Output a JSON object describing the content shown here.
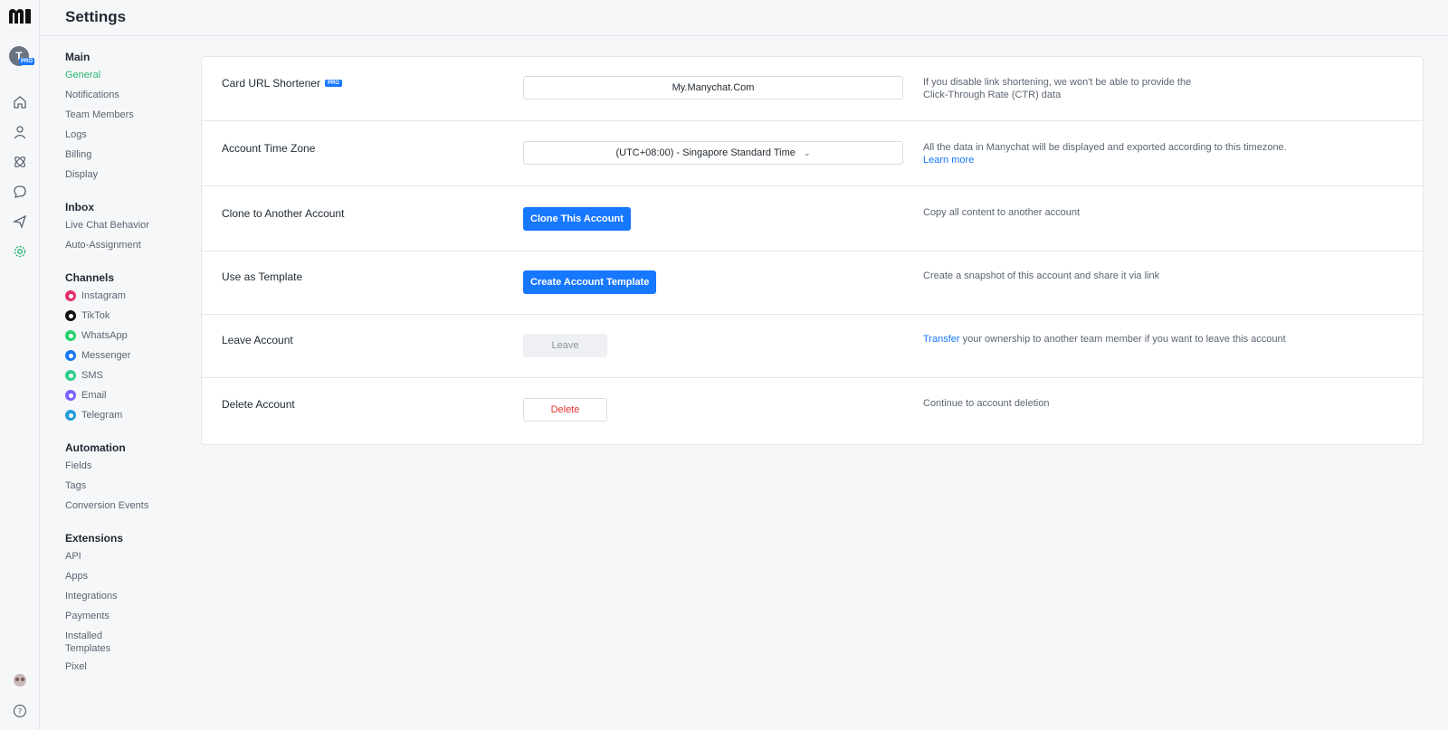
{
  "header": {
    "title": "Settings"
  },
  "rail": {
    "account_initial": "T",
    "account_badge": "PRO",
    "icons": [
      "home-icon",
      "contacts-icon",
      "automation-icon",
      "chat-icon",
      "broadcast-icon",
      "settings-icon",
      "avatar-icon",
      "help-icon"
    ]
  },
  "subnav": {
    "main": {
      "title": "Main",
      "items": [
        "General",
        "Notifications",
        "Team Members",
        "Logs",
        "Billing",
        "Display"
      ]
    },
    "inbox": {
      "title": "Inbox",
      "items": [
        "Live Chat Behavior",
        "Auto-Assignment"
      ]
    },
    "channels": {
      "title": "Channels",
      "items": [
        {
          "label": "Instagram",
          "color": "#e1306c"
        },
        {
          "label": "TikTok",
          "color": "#111111"
        },
        {
          "label": "WhatsApp",
          "color": "#25d366"
        },
        {
          "label": "Messenger",
          "color": "#1877f2"
        },
        {
          "label": "SMS",
          "color": "#2bd08a"
        },
        {
          "label": "Email",
          "color": "#7b61ff"
        },
        {
          "label": "Telegram",
          "color": "#229ed9"
        }
      ]
    },
    "automation": {
      "title": "Automation",
      "items": [
        "Fields",
        "Tags",
        "Conversion Events"
      ]
    },
    "extensions": {
      "title": "Extensions",
      "items": [
        "API",
        "Apps",
        "Integrations",
        "Payments",
        "Installed",
        "Templates",
        "Pixel"
      ]
    }
  },
  "settings": {
    "url_shortener": {
      "label": "Card URL Shortener",
      "badge": "PRO",
      "value": "My.Manychat.Com",
      "desc_line1": "If you disable link shortening, we won't be able to provide the",
      "desc_line2": "Click-Through Rate (CTR) data"
    },
    "time_zone": {
      "label": "Account Time Zone",
      "value": "(UTC+08:00) - Singapore Standard Time",
      "desc": "All the data in Manychat will be displayed and exported according to this timezone.",
      "link": "Learn more"
    },
    "clone": {
      "label": "Clone to Another Account",
      "button": "Clone This Account",
      "desc": "Copy all content to another account"
    },
    "template": {
      "label": "Use as Template",
      "button": "Create Account Template",
      "desc": "Create a snapshot of this account and share it via link"
    },
    "leave": {
      "label": "Leave Account",
      "button": "Leave",
      "link": "Transfer",
      "desc": " your ownership to another team member if you want to leave this account"
    },
    "delete": {
      "label": "Delete Account",
      "button": "Delete",
      "desc": "Continue to account deletion"
    }
  }
}
